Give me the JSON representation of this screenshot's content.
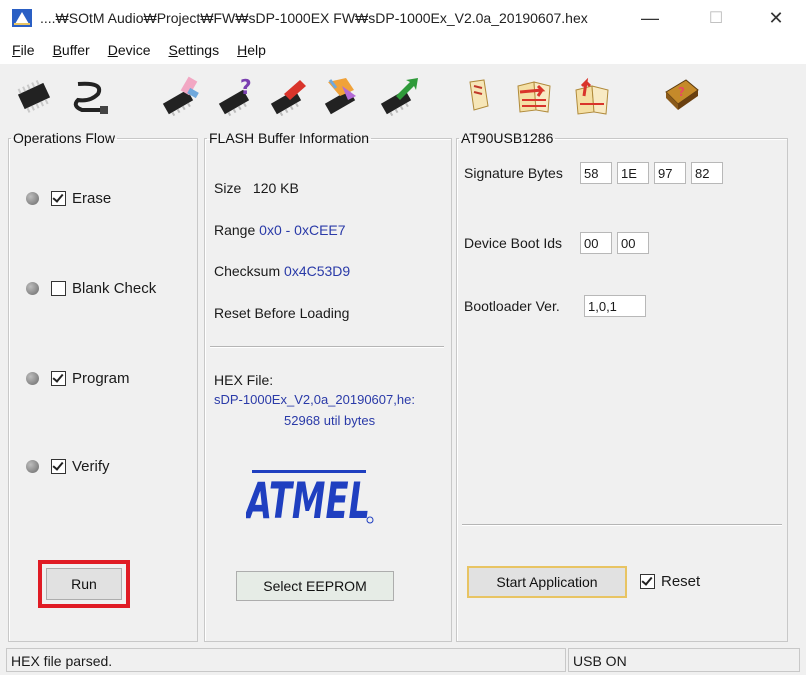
{
  "window": {
    "title": "....₩SOtM Audio₩Project₩FW₩sDP-1000EX FW₩sDP-1000Ex_V2.0a_20190607.hex",
    "minimize": "—",
    "maximize": "☐",
    "close": "✕"
  },
  "menu": {
    "items": [
      {
        "key": "F",
        "rest": "ile"
      },
      {
        "key": "B",
        "rest": "uffer"
      },
      {
        "key": "D",
        "rest": "evice"
      },
      {
        "key": "S",
        "rest": "ettings"
      },
      {
        "key": "H",
        "rest": "elp"
      }
    ]
  },
  "toolbar": {
    "icons": [
      "chip-icon",
      "usb-cable-icon",
      "chip-erase-icon",
      "chip-blank-check-icon",
      "chip-program-icon",
      "chip-verify-icon",
      "chip-run-icon",
      "open-file-icon",
      "load-hex-icon",
      "save-hex-icon",
      "help-book-icon"
    ]
  },
  "operations": {
    "legend": "Operations Flow",
    "erase": "Erase",
    "blank_check": "Blank Check",
    "program": "Program",
    "verify": "Verify",
    "run": "Run"
  },
  "flash": {
    "legend": "FLASH Buffer Information",
    "size_label": "Size",
    "size_value": "120 KB",
    "range_label": "Range",
    "range_value": "0x0 - 0xCEE7",
    "checksum_label": "Checksum",
    "checksum_value": "0x4C53D9",
    "reset_before": "Reset Before Loading",
    "hex_file_label": "HEX File:",
    "hex_file_name": "sDP-1000Ex_V2,0a_20190607,he:",
    "hex_bytes": "52968 util bytes",
    "logo": "ATMEL",
    "select_eeprom": "Select EEPROM"
  },
  "device": {
    "legend": "AT90USB1286",
    "signature_label": "Signature Bytes",
    "signature": [
      "58",
      "1E",
      "97",
      "82"
    ],
    "boot_ids_label": "Device Boot Ids",
    "boot_ids": [
      "00",
      "00"
    ],
    "bootloader_label": "Bootloader Ver.",
    "bootloader_value": "1,0,1",
    "start_application": "Start Application",
    "reset": "Reset"
  },
  "status": {
    "left": "HEX file parsed.",
    "right": "USB ON"
  },
  "colors": {
    "accent_blue": "#2a3aa8",
    "highlight_red": "#e01b24",
    "focus_yellow": "#e8c463"
  }
}
